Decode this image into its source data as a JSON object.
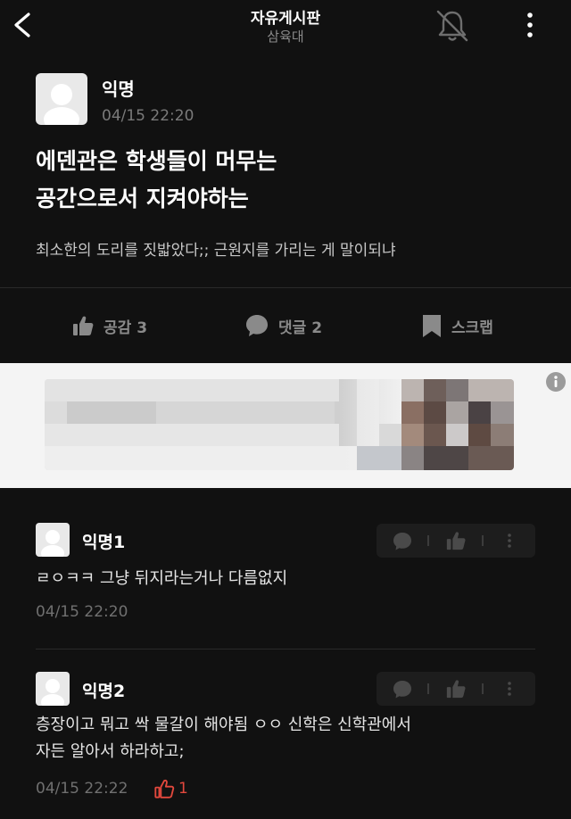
{
  "header": {
    "title": "자유게시판",
    "subtitle": "삼육대"
  },
  "post": {
    "author": "익명",
    "time": "04/15 22:20",
    "title_line1": "에덴관은 학생들이 머무는",
    "title_line2": "공간으로서 지켜야하는",
    "body": "최소한의 도리를 짓밟았다;; 근원지를 가리는 게 말이되냐"
  },
  "actions": {
    "like_label": "공감 3",
    "comment_label": "댓글 2",
    "scrap_label": "스크랩"
  },
  "comments": [
    {
      "author": "익명1",
      "text": "ㄹㅇㅋㅋ 그냥 뒤지라는거나 다름없지",
      "time": "04/15 22:20"
    },
    {
      "author": "익명2",
      "text_line1": "층장이고 뭐고 싹 물갈이 해야됨 ㅇㅇ 신학은 신학관에서",
      "text_line2": "자든 알아서 하라하고;",
      "time": "04/15 22:22",
      "likes": "1"
    }
  ],
  "colors": {
    "background": "#111111",
    "muted": "#8a8a8a",
    "like_red": "#e2483d"
  },
  "icons": [
    "back-chevron-icon",
    "bell-off-icon",
    "more-vertical-icon",
    "thumbs-up-icon",
    "speech-bubble-icon",
    "bookmark-icon",
    "info-icon"
  ]
}
